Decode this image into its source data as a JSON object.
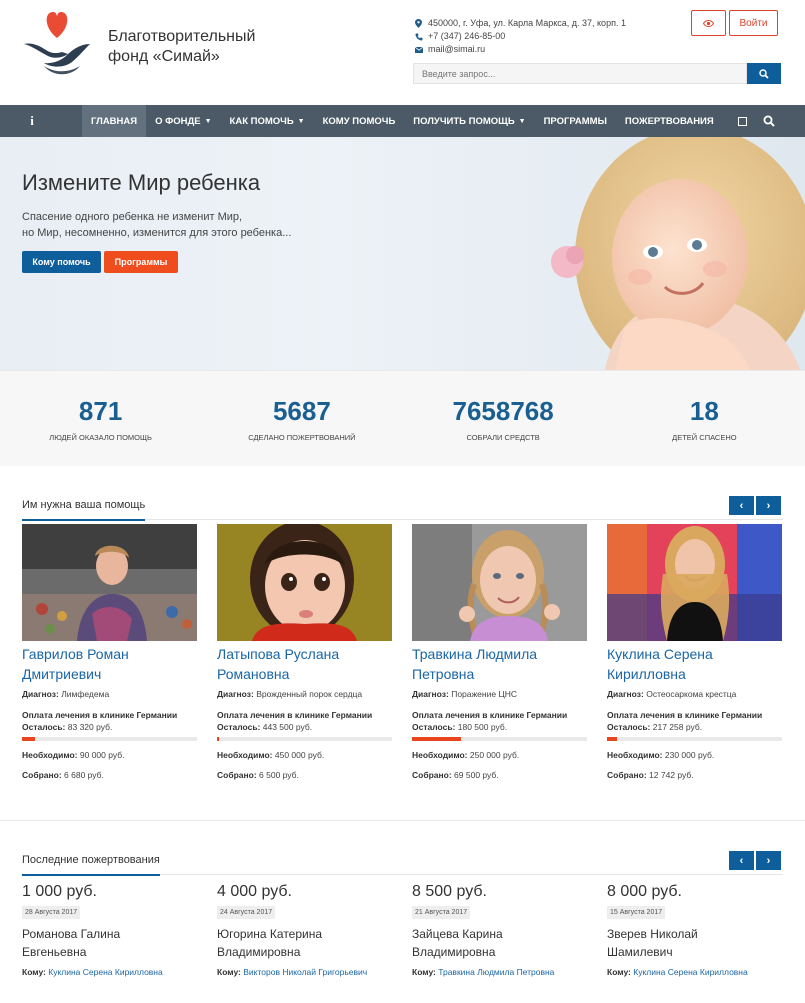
{
  "header": {
    "org_name_line1": "Благотворительный",
    "org_name_line2": "фонд «Симай»",
    "address": "450000, г. Уфа, ул. Карла Маркса, д. 37, корп. 1",
    "phone": "+7 (347) 246-85-00",
    "email": "mail@simai.ru",
    "login_label": "Войти",
    "search_placeholder": "Введите запрос...",
    "icons": [
      "heart-hands-logo",
      "map-pin-icon",
      "phone-icon",
      "mail-icon",
      "eye-icon",
      "search-icon"
    ]
  },
  "nav": {
    "info_label": "i",
    "items": [
      {
        "label": "Главная",
        "active": true,
        "caret": false
      },
      {
        "label": "О фонде",
        "active": false,
        "caret": true
      },
      {
        "label": "Как помочь",
        "active": false,
        "caret": true
      },
      {
        "label": "Кому помочь",
        "active": false,
        "caret": false
      },
      {
        "label": "Получить помощь",
        "active": false,
        "caret": true
      },
      {
        "label": "Программы",
        "active": false,
        "caret": false
      },
      {
        "label": "Пожертвования",
        "active": false,
        "caret": false
      }
    ]
  },
  "hero": {
    "title": "Измените Мир ребенка",
    "line1": "Спасение одного ребенка не изменит Мир,",
    "line2": "но Мир, несомненно, изменится для этого ребенка...",
    "btn_primary": "Кому помочь",
    "btn_secondary": "Программы"
  },
  "stats": [
    {
      "value": "871",
      "label": "Людей оказало помощь"
    },
    {
      "value": "5687",
      "label": "Сделано пожертвований"
    },
    {
      "value": "7658768",
      "label": "Собрали средств"
    },
    {
      "value": "18",
      "label": "Детей спасено"
    }
  ],
  "help": {
    "title": "Им нужна ваша помощь",
    "prev": "‹",
    "next": "›",
    "diag_label": "Диагноз:",
    "left_label": "Осталось:",
    "need_label": "Необходимо:",
    "got_label": "Собрано:",
    "cards": [
      {
        "name1": "Гаврилов Роман",
        "name2": "Дмитриевич",
        "diagnosis": "Лимфедема",
        "payment": "Оплата лечения в клинике Германии",
        "left": "83 320 руб.",
        "progress": 0.074,
        "need": "90 000 руб.",
        "collected": "6 680 руб."
      },
      {
        "name1": "Латыпова Руслана",
        "name2": "Романовна",
        "diagnosis": "Врожденный порок сердца",
        "payment": "Оплата лечения в клинике Германии",
        "left": "443 500 руб.",
        "progress": 0.014,
        "need": "450 000 руб.",
        "collected": "6 500 руб."
      },
      {
        "name1": "Травкина Людмила",
        "name2": "Петровна",
        "diagnosis": "Поражение ЦНС",
        "payment": "Оплата лечения в клинике Германии",
        "left": "180 500 руб.",
        "progress": 0.278,
        "need": "250 000 руб.",
        "collected": "69 500 руб."
      },
      {
        "name1": "Куклина Серена",
        "name2": "Кирилловна",
        "diagnosis": "Остеосаркома крестца",
        "payment": "Оплата лечения в клинике Германии",
        "left": "217 258 руб.",
        "progress": 0.055,
        "need": "230 000 руб.",
        "collected": "12 742 руб."
      }
    ]
  },
  "donations": {
    "title": "Последние пожертвования",
    "prev": "‹",
    "next": "›",
    "to_label": "Кому:",
    "items": [
      {
        "amount": "1 000 руб.",
        "date": "28 Августа 2017",
        "name1": "Романова Галина",
        "name2": "Евгеньевна",
        "to": "Куклина Серена Кирилловна"
      },
      {
        "amount": "4 000 руб.",
        "date": "24 Августа 2017",
        "name1": "Югорина Катерина",
        "name2": "Владимировна",
        "to": "Викторов Николай Григорьевич"
      },
      {
        "amount": "8 500 руб.",
        "date": "21 Августа 2017",
        "name1": "Зайцева Карина",
        "name2": "Владимировна",
        "to": "Травкина Людмила Петровна"
      },
      {
        "amount": "8 000 руб.",
        "date": "15 Августа 2017",
        "name1": "Зверев Николай",
        "name2": "Шамилевич",
        "to": "Куклина Серена Кирилловна"
      }
    ]
  },
  "colors": {
    "brand_blue": "#0f5e9c",
    "accent_red": "#f04d1e",
    "nav_bg": "#4b5a66",
    "stat_blue": "#1a5f92",
    "link_blue": "#1a66a6"
  }
}
